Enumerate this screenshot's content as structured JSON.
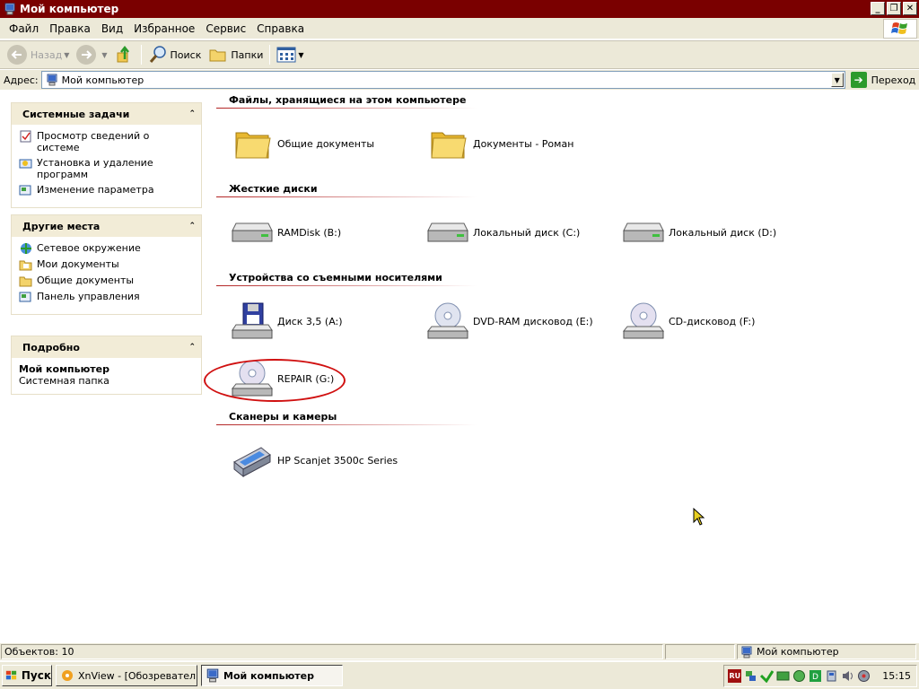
{
  "window": {
    "title": "Мой компьютер",
    "title_bar_color": "#7a0000",
    "controls": [
      "minimize-icon",
      "restore-icon",
      "close-icon"
    ]
  },
  "menu": [
    "Файл",
    "Правка",
    "Вид",
    "Избранное",
    "Сервис",
    "Справка"
  ],
  "toolbar": {
    "back_label": "Назад",
    "search_label": "Поиск",
    "folders_label": "Папки"
  },
  "address": {
    "label": "Адрес:",
    "value": "Мой компьютер",
    "go_label": "Переход"
  },
  "tasks": {
    "system": {
      "title": "Системные задачи",
      "items": [
        "Просмотр сведений о системе",
        "Установка и удаление программ",
        "Изменение параметра"
      ]
    },
    "places": {
      "title": "Другие места",
      "items": [
        "Сетевое окружение",
        "Мои документы",
        "Общие документы",
        "Панель управления"
      ]
    },
    "details": {
      "title": "Подробно",
      "name": "Мой компьютер",
      "type": "Системная папка"
    }
  },
  "groups": [
    {
      "title": "Файлы, хранящиеся на этом компьютере",
      "items": [
        {
          "label": "Общие документы",
          "icon": "folder-icon"
        },
        {
          "label": "Документы - Роман",
          "icon": "folder-icon"
        }
      ]
    },
    {
      "title": "Жесткие диски",
      "items": [
        {
          "label": "RAMDisk (B:)",
          "icon": "hard-drive-icon"
        },
        {
          "label": "Локальный диск (C:)",
          "icon": "hard-drive-icon"
        },
        {
          "label": "Локальный диск (D:)",
          "icon": "hard-drive-icon"
        }
      ]
    },
    {
      "title": "Устройства со съемными носителями",
      "items": [
        {
          "label": "Диск 3,5 (A:)",
          "icon": "floppy-drive-icon"
        },
        {
          "label": "DVD-RAM дисковод (E:)",
          "icon": "dvd-drive-icon"
        },
        {
          "label": "CD-дисковод (F:)",
          "icon": "cd-drive-icon"
        },
        {
          "label": "REPAIR (G:)",
          "icon": "cd-drive-icon"
        }
      ]
    },
    {
      "title": "Сканеры и камеры",
      "items": [
        {
          "label": "HP Scanjet 3500c Series",
          "icon": "scanner-icon"
        }
      ]
    }
  ],
  "status": {
    "objects": "Объектов: 10",
    "location": "Мой компьютер"
  },
  "taskbar": {
    "start_label": "Пуск",
    "tasks": [
      "XnView - [Обозреватель...",
      "Мой компьютер"
    ],
    "lang": "RU",
    "clock": "15:15"
  },
  "colors": {
    "highlight_ring": "#d01010",
    "group_line": "#b22222"
  }
}
